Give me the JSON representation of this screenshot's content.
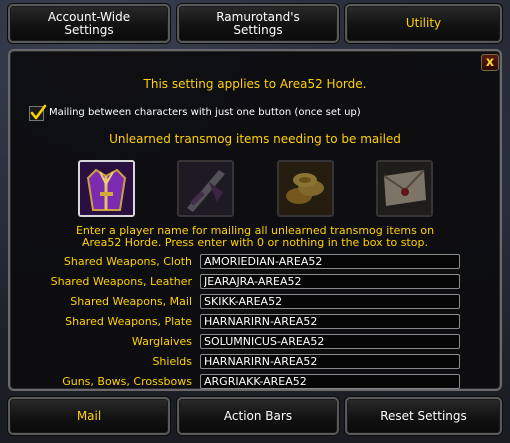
{
  "tabs": [
    {
      "label": "Account-Wide\nSettings",
      "active": false
    },
    {
      "label": "Ramurotand's\nSettings",
      "active": false
    },
    {
      "label": "Utility",
      "active": true
    }
  ],
  "notice": "This setting applies to Area52 Horde.",
  "checkbox": {
    "label": "Mailing between characters with just one button (once set up)",
    "checked": true
  },
  "section_title": "Unlearned transmog items needing to be mailed",
  "icons": [
    {
      "name": "transmog-robe-icon",
      "selected": true
    },
    {
      "name": "weapon-sword-icon",
      "selected": false
    },
    {
      "name": "gold-coins-icon",
      "selected": false
    },
    {
      "name": "mail-letter-icon",
      "selected": false
    }
  ],
  "description_line1": "Enter a player name for mailing all unlearned transmog items on",
  "description_line2": "Area52 Horde.  Press enter with 0 or nothing in the box to stop.",
  "rows": [
    {
      "label": "Shared Weapons, Cloth",
      "value": "AMORIEDIAN-AREA52"
    },
    {
      "label": "Shared Weapons, Leather",
      "value": "JEARAJRA-AREA52"
    },
    {
      "label": "Shared Weapons, Mail",
      "value": "SKIKK-AREA52"
    },
    {
      "label": "Shared Weapons, Plate",
      "value": "HARNARIRN-AREA52"
    },
    {
      "label": "Warglaives",
      "value": "SOLUMNICUS-AREA52"
    },
    {
      "label": "Shields",
      "value": "HARNARIRN-AREA52"
    },
    {
      "label": "Guns, Bows, Crossbows",
      "value": "ARGRIAKK-AREA52"
    }
  ],
  "bottom_buttons": [
    {
      "label": "Mail",
      "active": true
    },
    {
      "label": "Action Bars",
      "active": false
    },
    {
      "label": "Reset Settings",
      "active": false
    }
  ],
  "close_label": "x",
  "colors": {
    "gold": "#ffd100",
    "white": "#ffffff"
  }
}
